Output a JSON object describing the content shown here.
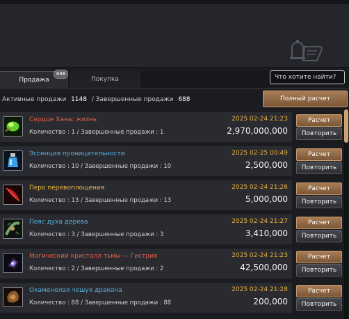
{
  "tabs": {
    "sales": "Продажа",
    "sales_badge": "688",
    "purchase": "Покупка"
  },
  "search": {
    "placeholder": "Что хотите найти?"
  },
  "summary": {
    "active_label": "Активные продажи",
    "active_count": "1148",
    "separator": "/",
    "completed_label": "Завершенные продажи",
    "completed_count": "688"
  },
  "full_calc_label": "Полный расчет",
  "items": [
    {
      "name": "Сердце Хана: жизнь",
      "name_color": "#e0614b",
      "qty": "Количество : 1 / Завершенные продажи : 1",
      "date": "2025 02-24 21:23",
      "price": "2,970,000,000",
      "icon": "green-orb-icon"
    },
    {
      "name": "Эссенция проницательности",
      "name_color": "#5aaee0",
      "qty": "Количество : 10 / Завершенные продажи : 10",
      "date": "2025 02-25 00:49",
      "price": "2,500,000",
      "icon": "blue-potion-icon"
    },
    {
      "name": "Перо перевоплощения",
      "name_color": "#f0b63c",
      "qty": "Количество : 13 / Завершенные продажи : 13",
      "date": "2025 02-24 21:26",
      "price": "5,000,000",
      "icon": "red-feather-icon"
    },
    {
      "name": "Пояс духа дерева",
      "name_color": "#5aaee0",
      "qty": "Количество : 3 / Завершенные продажи : 3",
      "date": "2025 02-24 21:27",
      "price": "3,410,000",
      "icon": "belt-icon"
    },
    {
      "name": "Магический кристалл тьмы — Гистрия",
      "name_color": "#e0614b",
      "qty": "Количество : 2 / Завершенные продажи : 2",
      "date": "2025 02-24 21:23",
      "price": "42,500,000",
      "icon": "dark-crystal-icon"
    },
    {
      "name": "Окаменелая чешуя дракона",
      "name_color": "#5aaee0",
      "qty": "Количество : 88 / Завершенные продажи : 88",
      "date": "2025 02-24 21:28",
      "price": "200,000",
      "icon": "dragon-scale-icon"
    }
  ],
  "buttons": {
    "calc": "Расчет",
    "repeat": "Повторить"
  }
}
